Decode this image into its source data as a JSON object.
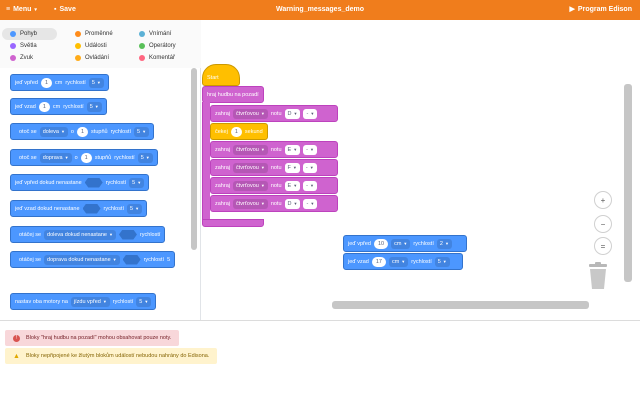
{
  "topbar": {
    "menu_label": "Menu",
    "save_label": "Save",
    "title": "Warning_messages_demo",
    "program_label": "Program Edison"
  },
  "categories": [
    {
      "label": "Pohyb",
      "color": "#4c97ff"
    },
    {
      "label": "Proměnné",
      "color": "#ff8c1a"
    },
    {
      "label": "Vnímání",
      "color": "#5cb1d6"
    },
    {
      "label": "Světla",
      "color": "#9966ff"
    },
    {
      "label": "Události",
      "color": "#ffbf00"
    },
    {
      "label": "Operátory",
      "color": "#59c059"
    },
    {
      "label": "Zvuk",
      "color": "#cf63cf"
    },
    {
      "label": "Ovládání",
      "color": "#ffab19"
    },
    {
      "label": "Komentář",
      "color": "#ff6680"
    }
  ],
  "palette": {
    "b1": {
      "pre": "jeď vpřed",
      "val": "1",
      "unit": "cm",
      "speed_label": "rychlostí",
      "speed": "5"
    },
    "b2": {
      "pre": "jeď vzad",
      "val": "1",
      "unit": "cm",
      "speed_label": "rychlostí",
      "speed": "5"
    },
    "b3": {
      "pre": "otoč se",
      "dir": "doleva",
      "o": "o",
      "val": "1",
      "unit": "stupňů",
      "speed_label": "rychlostí",
      "speed": "5"
    },
    "b4": {
      "pre": "otoč se",
      "dir": "doprava",
      "o": "o",
      "val": "1",
      "unit": "stupňů",
      "speed_label": "rychlostí",
      "speed": "5"
    },
    "b5": {
      "pre": "jeď vpřed dokud nenastane",
      "speed_label": "rychlostí",
      "speed": "5"
    },
    "b6": {
      "pre": "jeď vzad dokud nenastane",
      "speed_label": "rychlostí",
      "speed": "5"
    },
    "b7": {
      "pre": "otáčej se",
      "dir": "doleva dokud nenastane",
      "speed_label": "rychlostí"
    },
    "b8": {
      "pre": "otáčej se",
      "dir": "doprava dokud nenastane",
      "speed_label": "rychlostí",
      "speed": "5"
    },
    "b9": {
      "pre": "nastav oba motory na",
      "mode": "jízdu vpřed",
      "speed_label": "rychlostí",
      "speed": "5"
    }
  },
  "script": {
    "start": "Start",
    "bg_music": "hraj hudbu na pozadí",
    "notes": [
      {
        "verb": "zahraj",
        "len": "čtvrťovou",
        "note_label": "notu",
        "note": "D",
        "oct": "-"
      },
      {
        "verb": "zahraj",
        "len": "čtvrťovou",
        "note_label": "notu",
        "note": "E",
        "oct": "-"
      },
      {
        "verb": "zahraj",
        "len": "čtvrťovou",
        "note_label": "notu",
        "note": "F",
        "oct": "-"
      },
      {
        "verb": "zahraj",
        "len": "čtvrťovou",
        "note_label": "notu",
        "note": "E",
        "oct": "-"
      },
      {
        "verb": "zahraj",
        "len": "čtvrťovou",
        "note_label": "notu",
        "note": "D",
        "oct": "-"
      }
    ],
    "wait": {
      "pre": "čekej",
      "val": "1",
      "unit": "sekund"
    }
  },
  "loose": {
    "fwd": {
      "pre": "jeď vpřed",
      "val": "10",
      "unit": "cm",
      "speed_label": "rychlostí",
      "speed": "2"
    },
    "back": {
      "pre": "jeď vzad",
      "val": "17",
      "unit": "cm",
      "speed_label": "rychlostí",
      "speed": "5"
    }
  },
  "zoom": {
    "in": "+",
    "out": "−",
    "reset": "="
  },
  "messages": {
    "error": "Bloky \"hraj hudbu na pozadí\" mohou obsahovat pouze noty.",
    "warning": "Bloky nepřipojené ke žlutým blokům událostí nebudou nahrány do Edisona."
  }
}
